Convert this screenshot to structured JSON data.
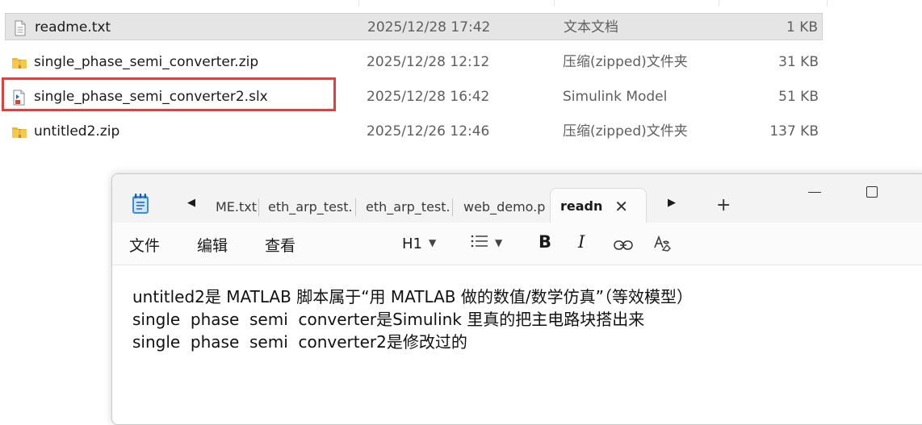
{
  "explorer": {
    "files": [
      {
        "name": "readme.txt",
        "date": "2025/12/28 17:42",
        "type": "文本文档",
        "size": "1 KB",
        "icon": "text-file-icon",
        "selected": true
      },
      {
        "name": "single_phase_semi_converter.zip",
        "date": "2025/12/28 12:12",
        "type": "压缩(zipped)文件夹",
        "size": "31 KB",
        "icon": "zip-folder-icon",
        "selected": false
      },
      {
        "name": "single_phase_semi_converter2.slx",
        "date": "2025/12/28 16:42",
        "type": "Simulink Model",
        "size": "51 KB",
        "icon": "simulink-file-icon",
        "selected": false,
        "highlighted": true
      },
      {
        "name": "untitled2.zip",
        "date": "2025/12/26 12:46",
        "type": "压缩(zipped)文件夹",
        "size": "137 KB",
        "icon": "zip-folder-icon",
        "selected": false
      }
    ],
    "highlight_color": "#e0403f"
  },
  "notepad": {
    "tabs": [
      {
        "label": "ME.txt"
      },
      {
        "label": "eth_arp_test."
      },
      {
        "label": "eth_arp_test."
      },
      {
        "label": "web_demo.p"
      }
    ],
    "active_tab": {
      "label": "readn",
      "close": "✕"
    },
    "new_tab": "+",
    "menu": {
      "file": "文件",
      "edit": "编辑",
      "view": "查看"
    },
    "toolbar": {
      "heading": "H1",
      "list_icon": "bulleted-list-icon",
      "bold": "B",
      "italic": "I",
      "link_icon": "link-icon",
      "clear_format_icon": "clear-formatting-icon"
    },
    "content": [
      "untitled2是 MATLAB 脚本属于“用 MATLAB 做的数值/数学仿真”（等效模型）",
      "single  phase  semi  converter是Simulink 里真的把主电路块搭出来",
      "single  phase  semi  converter2是修改过的"
    ]
  }
}
